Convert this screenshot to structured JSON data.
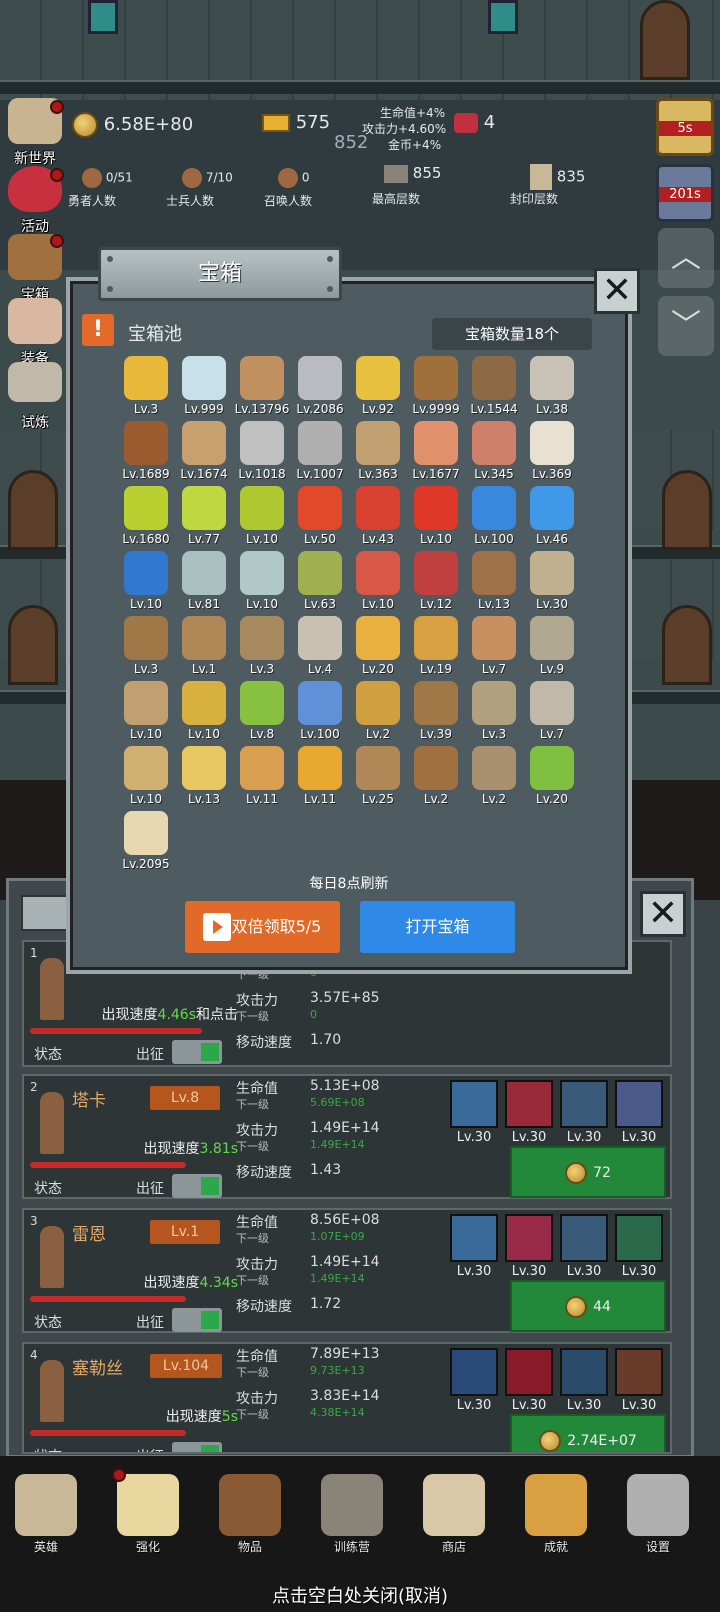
{
  "resources": {
    "gold": "6.58E+80",
    "bar": "575",
    "meat": "4",
    "center_value": "852",
    "bonus_hp": "生命值+4%",
    "bonus_atk": "攻击力+4.60%",
    "bonus_gold": "金币+4%",
    "heroes_count": "0/51",
    "heroes_label": "勇者人数",
    "soldiers_count": "7/10",
    "soldiers_label": "士兵人数",
    "summon_count": "0",
    "summon_label": "召唤人数",
    "max_floor": "855",
    "max_floor_label": "最高层数",
    "seal_floor": "835",
    "seal_floor_label": "封印层数"
  },
  "sidebar": [
    {
      "label": "新世界"
    },
    {
      "label": "活动"
    },
    {
      "label": "宝箱"
    },
    {
      "label": "装备"
    },
    {
      "label": "试炼"
    }
  ],
  "right_timers": {
    "t1": "5s",
    "t2": "201s"
  },
  "modal": {
    "title": "宝箱",
    "pool_label": "宝箱池",
    "count_label": "宝箱数量18个",
    "refresh_note": "每日8点刷新",
    "double_button": "双倍领取5/5",
    "open_button": "打开宝箱"
  },
  "items": [
    {
      "icon": "crown-icon",
      "color": "#e8b838",
      "lv": "Lv.3"
    },
    {
      "icon": "diamond-icon",
      "color": "#c8e0ea",
      "lv": "Lv.999"
    },
    {
      "icon": "wood-sword-icon",
      "color": "#c09060",
      "lv": "Lv.13796"
    },
    {
      "icon": "iron-sword-icon",
      "color": "#b8bcc0",
      "lv": "Lv.2086"
    },
    {
      "icon": "gold-sword-icon",
      "color": "#e8c040",
      "lv": "Lv.92"
    },
    {
      "icon": "leather-armor-icon",
      "color": "#a0703c",
      "lv": "Lv.9999"
    },
    {
      "icon": "backpack-armor-icon",
      "color": "#8c6a44",
      "lv": "Lv.1544"
    },
    {
      "icon": "iron-armor-icon",
      "color": "#c8c2b4",
      "lv": "Lv.38"
    },
    {
      "icon": "leather-helmet-icon",
      "color": "#9c5c30",
      "lv": "Lv.1689"
    },
    {
      "icon": "short-sword-icon",
      "color": "#c8a070",
      "lv": "Lv.1674"
    },
    {
      "icon": "iron-helmet-icon",
      "color": "#c0c0c0",
      "lv": "Lv.1018"
    },
    {
      "icon": "hammer-icon",
      "color": "#b0b0b0",
      "lv": "Lv.1007"
    },
    {
      "icon": "knight-helmet-icon",
      "color": "#c0a070",
      "lv": "Lv.363"
    },
    {
      "icon": "ham-icon",
      "color": "#e0906a",
      "lv": "Lv.1677"
    },
    {
      "icon": "steak-icon",
      "color": "#d0806a",
      "lv": "Lv.345"
    },
    {
      "icon": "rice-bowl-icon",
      "color": "#e8e0d0",
      "lv": "Lv.369"
    },
    {
      "icon": "yellow-potion-icon",
      "color": "#b8d030",
      "lv": "Lv.1680"
    },
    {
      "icon": "yellow-potion-icon",
      "color": "#c0d840",
      "lv": "Lv.77"
    },
    {
      "icon": "yellow-potion-icon",
      "color": "#b0c830",
      "lv": "Lv.10"
    },
    {
      "icon": "red-potion-icon",
      "color": "#e04a2a",
      "lv": "Lv.50"
    },
    {
      "icon": "red-potion-icon",
      "color": "#d84030",
      "lv": "Lv.43"
    },
    {
      "icon": "red-potion-icon",
      "color": "#e03828",
      "lv": "Lv.10"
    },
    {
      "icon": "blue-potion-icon",
      "color": "#3888e0",
      "lv": "Lv.100"
    },
    {
      "icon": "blue-potion-icon",
      "color": "#4098e8",
      "lv": "Lv.46"
    },
    {
      "icon": "blue-potion-icon",
      "color": "#3078d0",
      "lv": "Lv.10"
    },
    {
      "icon": "empty-bottle-icon",
      "color": "#a8c0c0",
      "lv": "Lv.81"
    },
    {
      "icon": "empty-bottle-icon",
      "color": "#b0c8c8",
      "lv": "Lv.10"
    },
    {
      "icon": "green-bottle-icon",
      "color": "#a0b050",
      "lv": "Lv.63"
    },
    {
      "icon": "red-bottle-icon",
      "color": "#d85848",
      "lv": "Lv.10"
    },
    {
      "icon": "magic-boot-icon",
      "color": "#c04040",
      "lv": "Lv.12"
    },
    {
      "icon": "leather-boot-icon",
      "color": "#a07048",
      "lv": "Lv.13"
    },
    {
      "icon": "cloth-boot-icon",
      "color": "#c0b090",
      "lv": "Lv.30"
    },
    {
      "icon": "round-shield-icon",
      "color": "#a07848",
      "lv": "Lv.3"
    },
    {
      "icon": "wood-stick-icon",
      "color": "#b08858",
      "lv": "Lv.1"
    },
    {
      "icon": "kite-shield-icon",
      "color": "#a88a60",
      "lv": "Lv.3"
    },
    {
      "icon": "dagger-icon",
      "color": "#c8c0b0",
      "lv": "Lv.4"
    },
    {
      "icon": "torch-icon",
      "color": "#e8b040",
      "lv": "Lv.20"
    },
    {
      "icon": "staff-icon",
      "color": "#d8a040",
      "lv": "Lv.19"
    },
    {
      "icon": "mushroom-icon",
      "color": "#c89060",
      "lv": "Lv.7"
    },
    {
      "icon": "pickaxe-icon",
      "color": "#b0a890",
      "lv": "Lv.9"
    },
    {
      "icon": "crook-icon",
      "color": "#c0a070",
      "lv": "Lv.10"
    },
    {
      "icon": "potato-icon",
      "color": "#d8b040",
      "lv": "Lv.10"
    },
    {
      "icon": "lime-icon",
      "color": "#88c040",
      "lv": "Lv.8"
    },
    {
      "icon": "magic-wand-icon",
      "color": "#6090d8",
      "lv": "Lv.100"
    },
    {
      "icon": "ruby-wand-icon",
      "color": "#d0a040",
      "lv": "Lv.2"
    },
    {
      "icon": "bag-icon",
      "color": "#a07848",
      "lv": "Lv.39"
    },
    {
      "icon": "shovel-icon",
      "color": "#b0a080",
      "lv": "Lv.3"
    },
    {
      "icon": "axe-icon",
      "color": "#c0b8a8",
      "lv": "Lv.7"
    },
    {
      "icon": "club-icon",
      "color": "#d0b070",
      "lv": "Lv.10"
    },
    {
      "icon": "cheese-icon",
      "color": "#e8c860",
      "lv": "Lv.13"
    },
    {
      "icon": "pie-icon",
      "color": "#d8a050",
      "lv": "Lv.11"
    },
    {
      "icon": "honey-jar-icon",
      "color": "#e8a830",
      "lv": "Lv.11"
    },
    {
      "icon": "bow-icon",
      "color": "#b08858",
      "lv": "Lv.25"
    },
    {
      "icon": "belt-icon",
      "color": "#a07040",
      "lv": "Lv.2"
    },
    {
      "icon": "arrow-icon",
      "color": "#a89070",
      "lv": "Lv.2"
    },
    {
      "icon": "green-wand-icon",
      "color": "#80c040",
      "lv": "Lv.20"
    },
    {
      "icon": "beer-mug-icon",
      "color": "#e8d8b0",
      "lv": "Lv.2095"
    }
  ],
  "heroes": [
    {
      "num": "1",
      "name": "",
      "lv": "",
      "speed_prefix": "出现速度",
      "speed": "4.46s",
      "speed_suffix": "和点击",
      "hp": "",
      "hp_next": "0",
      "atk": "3.57E+85",
      "atk_next": "0",
      "move": "1.70",
      "skills": [],
      "buy": "",
      "state": "状态",
      "go": "出征"
    },
    {
      "num": "2",
      "name": "塔卡",
      "lv": "Lv.8",
      "speed_prefix": "出现速度",
      "speed": "3.81s",
      "speed_suffix": "",
      "hp": "5.13E+08",
      "hp_next": "5.69E+08",
      "atk": "1.49E+14",
      "atk_next": "1.49E+14",
      "move": "1.43",
      "skills": [
        {
          "icon": "axe-skill-icon",
          "color": "#3a6a9a",
          "lv": "Lv.30"
        },
        {
          "icon": "cleave-skill-icon",
          "color": "#9a2a3a",
          "lv": "Lv.30"
        },
        {
          "icon": "boot-skill-icon",
          "color": "#3a5a7a",
          "lv": "Lv.30"
        },
        {
          "icon": "hammer-skill-icon",
          "color": "#4a5a8a",
          "lv": "Lv.30"
        }
      ],
      "buy": "72",
      "state": "状态",
      "go": "出征"
    },
    {
      "num": "3",
      "name": "雷恩",
      "lv": "Lv.1",
      "speed_prefix": "出现速度",
      "speed": "4.34s",
      "speed_suffix": "",
      "hp": "8.56E+08",
      "hp_next": "1.07E+09",
      "atk": "1.49E+14",
      "atk_next": "1.49E+14",
      "move": "1.72",
      "skills": [
        {
          "icon": "sword-skill-icon",
          "color": "#3a6a9a",
          "lv": "Lv.30"
        },
        {
          "icon": "slash-skill-icon",
          "color": "#9a2a4a",
          "lv": "Lv.30"
        },
        {
          "icon": "boot-skill-icon",
          "color": "#3a5a7a",
          "lv": "Lv.30"
        },
        {
          "icon": "beast-skill-icon",
          "color": "#2a6a4a",
          "lv": "Lv.30"
        }
      ],
      "buy": "44",
      "state": "状态",
      "go": "出征"
    },
    {
      "num": "4",
      "name": "塞勒丝",
      "lv": "Lv.104",
      "speed_prefix": "出现速度",
      "speed": "5s",
      "speed_suffix": "",
      "hp": "7.89E+13",
      "hp_next": "9.73E+13",
      "atk": "3.83E+14",
      "atk_next": "4.38E+14",
      "move": "",
      "skills": [
        {
          "icon": "star-shield-skill-icon",
          "color": "#2a4a7a",
          "lv": "Lv.30"
        },
        {
          "icon": "monster-skill-icon",
          "color": "#8a1a2a",
          "lv": "Lv.30"
        },
        {
          "icon": "boot-skill-icon",
          "color": "#2a4a6a",
          "lv": "Lv.30"
        },
        {
          "icon": "lantern-skill-icon",
          "color": "#6a3a2a",
          "lv": "Lv.30"
        }
      ],
      "buy": "2.74E+07",
      "state": "状态",
      "go": "出征"
    }
  ],
  "hero_labels": {
    "hp": "生命值",
    "atk": "攻击力",
    "next": "下一级",
    "move": "移动速度"
  },
  "nav": [
    {
      "label": "英雄",
      "icon": "skull-icon",
      "color": "#c8b898"
    },
    {
      "label": "强化",
      "icon": "candle-icon",
      "color": "#e8d8a0"
    },
    {
      "label": "物品",
      "icon": "book-icon",
      "color": "#8a5a34"
    },
    {
      "label": "训练营",
      "icon": "lantern-icon",
      "color": "#8a8478"
    },
    {
      "label": "商店",
      "icon": "beer-mug-icon",
      "color": "#d8c8a8"
    },
    {
      "label": "成就",
      "icon": "key-icon",
      "color": "#d8a040"
    },
    {
      "label": "设置",
      "icon": "gear-icon",
      "color": "#b0b0b0"
    }
  ],
  "close_hint": "点击空白处关闭(取消)"
}
